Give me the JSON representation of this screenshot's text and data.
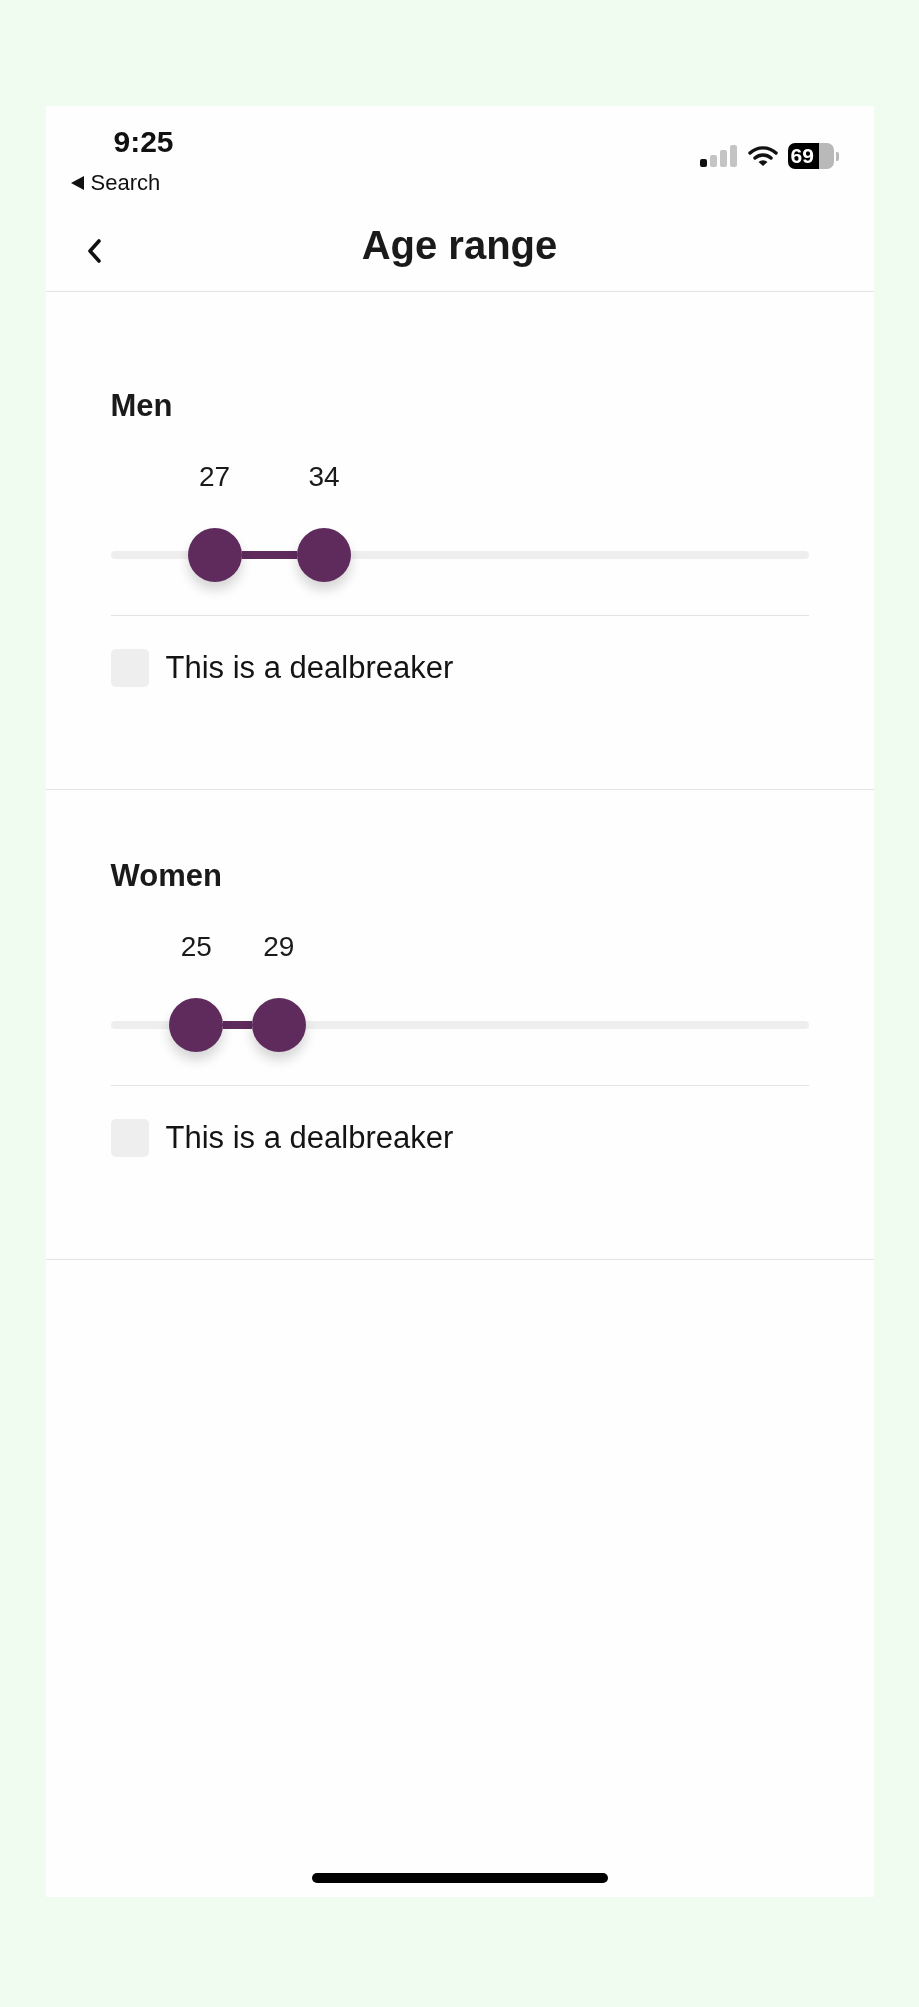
{
  "status_bar": {
    "time": "9:25",
    "back_link": "Search",
    "battery": "69"
  },
  "header": {
    "title": "Age range"
  },
  "sections": [
    {
      "title": "Men",
      "slider": {
        "thumbs": [
          {
            "reading": "27",
            "level": 0.149
          },
          {
            "reading": "34",
            "level": 0.306
          }
        ]
      },
      "dealbreaker": {
        "label": "This is a dealbreaker",
        "checked": false
      }
    },
    {
      "title": "Women",
      "slider": {
        "thumbs": [
          {
            "reading": "25",
            "level": 0.123
          },
          {
            "reading": "29",
            "level": 0.241
          }
        ]
      },
      "dealbreaker": {
        "label": "This is a dealbreaker",
        "checked": false
      }
    }
  ]
}
